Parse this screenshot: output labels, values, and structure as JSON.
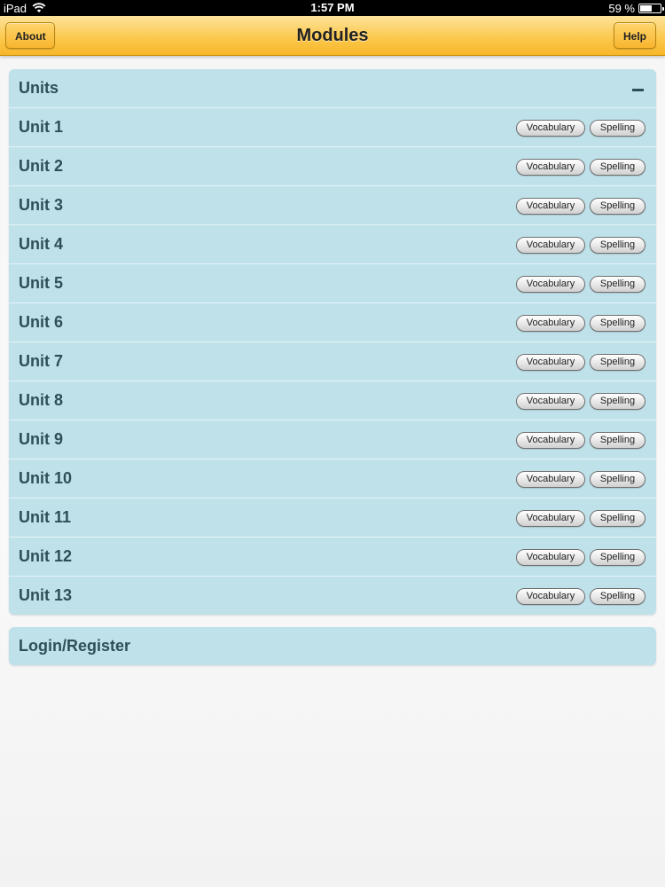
{
  "status_bar": {
    "device": "iPad",
    "time": "1:57 PM",
    "battery_text": "59 %",
    "battery_level": 0.59
  },
  "nav": {
    "title": "Modules",
    "about_label": "About",
    "help_label": "Help"
  },
  "units_panel": {
    "title": "Units",
    "rows": [
      {
        "label": "Unit 1",
        "vocab": "Vocabulary",
        "spell": "Spelling"
      },
      {
        "label": "Unit 2",
        "vocab": "Vocabulary",
        "spell": "Spelling"
      },
      {
        "label": "Unit 3",
        "vocab": "Vocabulary",
        "spell": "Spelling"
      },
      {
        "label": "Unit 4",
        "vocab": "Vocabulary",
        "spell": "Spelling"
      },
      {
        "label": "Unit 5",
        "vocab": "Vocabulary",
        "spell": "Spelling"
      },
      {
        "label": "Unit 6",
        "vocab": "Vocabulary",
        "spell": "Spelling"
      },
      {
        "label": "Unit 7",
        "vocab": "Vocabulary",
        "spell": "Spelling"
      },
      {
        "label": "Unit 8",
        "vocab": "Vocabulary",
        "spell": "Spelling"
      },
      {
        "label": "Unit 9",
        "vocab": "Vocabulary",
        "spell": "Spelling"
      },
      {
        "label": "Unit 10",
        "vocab": "Vocabulary",
        "spell": "Spelling"
      },
      {
        "label": "Unit 11",
        "vocab": "Vocabulary",
        "spell": "Spelling"
      },
      {
        "label": "Unit 12",
        "vocab": "Vocabulary",
        "spell": "Spelling"
      },
      {
        "label": "Unit 13",
        "vocab": "Vocabulary",
        "spell": "Spelling"
      }
    ]
  },
  "login_panel": {
    "label": "Login/Register"
  },
  "colors": {
    "nav_accent": "#fcc94f",
    "panel_background": "#bfe1ea",
    "panel_text": "#2f4f58"
  }
}
